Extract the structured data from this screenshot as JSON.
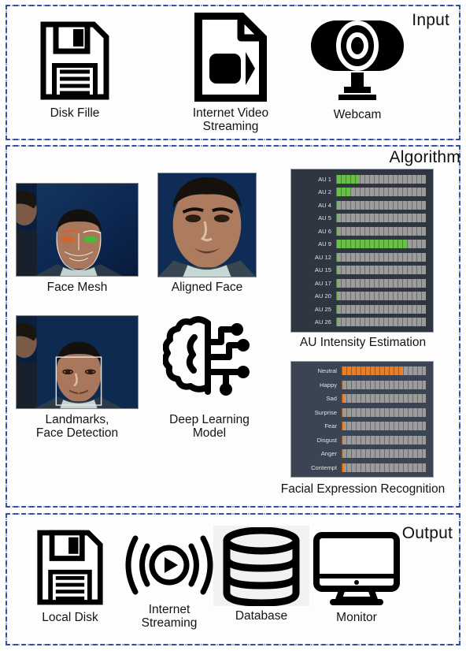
{
  "sections": {
    "input": {
      "title": "Input",
      "items": [
        {
          "label": "Disk Fille",
          "icon": "floppy-disk-icon"
        },
        {
          "label": "Internet Video\nStreaming",
          "icon": "video-file-icon"
        },
        {
          "label": "Webcam",
          "icon": "webcam-icon"
        }
      ]
    },
    "algorithm": {
      "title": "Algorithm",
      "thumbnails": [
        {
          "label": "Face Mesh",
          "icon": "face-mesh-image"
        },
        {
          "label": "Aligned Face",
          "icon": "aligned-face-image"
        },
        {
          "label": "Landmarks,\nFace Detection",
          "icon": "landmarks-face-detection-image"
        },
        {
          "label": "Deep Learning\nModel",
          "icon": "brain-circuit-icon"
        }
      ],
      "au_caption": "AU Intensity Estimation",
      "fer_caption": "Facial Expression Recognition"
    },
    "output": {
      "title": "Output",
      "items": [
        {
          "label": "Local Disk",
          "icon": "floppy-disk-icon"
        },
        {
          "label": "Internet\nStreaming",
          "icon": "streaming-broadcast-icon"
        },
        {
          "label": "Database",
          "icon": "database-cylinder-icon"
        },
        {
          "label": "Monitor",
          "icon": "monitor-icon"
        }
      ]
    }
  },
  "colors": {
    "panel_border": "#2b4a9b",
    "au_bar": "#6abf4b",
    "fer_bar": "#ed7d1f",
    "au_panel_bg": "#2f3642",
    "fer_panel_bg": "#3a4452",
    "track_bg": "#9b9b9b"
  },
  "chart_data": [
    {
      "type": "bar",
      "title": "AU Intensity Estimation",
      "orientation": "horizontal",
      "categories": [
        "AU 1",
        "AU 2",
        "AU 4",
        "AU 5",
        "AU 6",
        "AU 9",
        "AU 12",
        "AU 15",
        "AU 17",
        "AU 20",
        "AU 25",
        "AU 26"
      ],
      "values": [
        25,
        16,
        2,
        0,
        2,
        80,
        2,
        2,
        2,
        3,
        2,
        2
      ],
      "xlabel": "",
      "ylabel": "",
      "xlim": [
        0,
        100
      ],
      "bar_color": "#6abf4b",
      "grid": false,
      "legend": "none"
    },
    {
      "type": "bar",
      "title": "Facial Expression Recognition",
      "orientation": "horizontal",
      "categories": [
        "Neutral",
        "Happy",
        "Sad",
        "Surprise",
        "Fear",
        "Disgust",
        "Anger",
        "Contempt"
      ],
      "values": [
        72,
        2,
        3,
        2,
        3,
        2,
        2,
        3
      ],
      "xlabel": "",
      "ylabel": "",
      "xlim": [
        0,
        100
      ],
      "bar_color": "#ed7d1f",
      "grid": false,
      "legend": "none"
    }
  ]
}
